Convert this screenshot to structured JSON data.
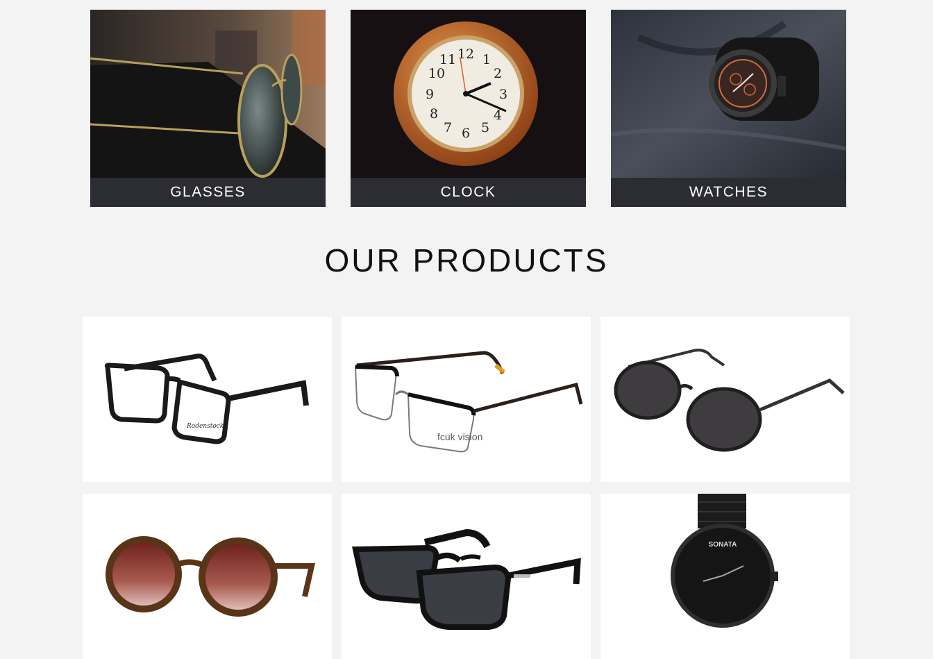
{
  "categories": [
    {
      "label": "GLASSES",
      "icon": "glasses-photo"
    },
    {
      "label": "CLOCK",
      "icon": "wall-clock-photo"
    },
    {
      "label": "WATCHES",
      "icon": "wristwatch-photo"
    }
  ],
  "products_section": {
    "title": "OUR PRODUCTS",
    "items": [
      {
        "icon": "rectangular-eyeglasses-image",
        "imprint": "Rodenstock"
      },
      {
        "icon": "half-rim-eyeglasses-image",
        "imprint": "fcuk vision"
      },
      {
        "icon": "round-sunglasses-image"
      },
      {
        "icon": "tortoise-round-sunglasses-image"
      },
      {
        "icon": "black-wayfarer-sunglasses-image"
      },
      {
        "icon": "black-wristwatch-image",
        "imprint": "SONATA"
      }
    ]
  },
  "clock": {
    "numerals": [
      "12",
      "1",
      "2",
      "3",
      "4",
      "5",
      "6",
      "7",
      "8",
      "9",
      "10",
      "11"
    ]
  }
}
